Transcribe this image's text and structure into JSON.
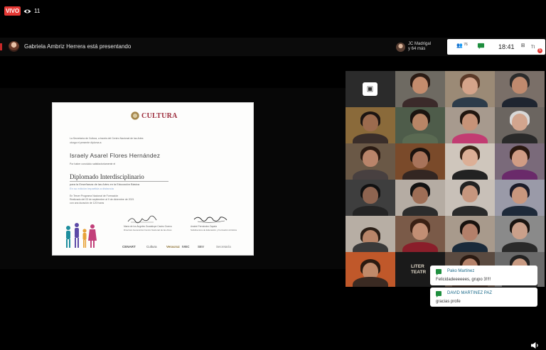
{
  "stream": {
    "live_label": "VIVO",
    "viewers_count": "11"
  },
  "meet": {
    "presenting_text": "Gabriela Ambriz Herrera está presentando",
    "participants_name": "JC Madrigal",
    "participants_more": "y 64 más",
    "participants_badge": "76",
    "time": "18:41",
    "notification_count": "5",
    "accent_color": "#1e8e3e",
    "live_color": "#e53935"
  },
  "diploma": {
    "logo_text": "CULTURA",
    "intro_lines": [
      "La Secretaría de Cultura, a través del Centro Nacional de las Artes",
      "otorga el presente diploma a:"
    ],
    "recipient": "Israely Asarel Flores Hernández",
    "reason": "Por haber concluido satisfactoriamente el",
    "program": "Diplomado Interdisciplinario",
    "program_sub": "para la Enseñanza de las Artes en la Educación Básica",
    "program_sub2": "En su edición impartida a distancia",
    "detail_lines": [
      "En Tercer Programa Nacional de Formación",
      "Realizado del 03 de septiembre al 9 de diciembre de 2021",
      "con una duración de 120 horas"
    ],
    "signer_left": "María de los Ángeles Guadalupe Castro Guerra",
    "signer_left_role": "Directora General del Centro Nacional de las Artes",
    "signer_right": "Anabel Fernández Zapata",
    "signer_right_role": "Subdirectora de Educación y Formación Artística",
    "footer_logos": [
      "CENART",
      "Cultura",
      "Veracruz",
      "IVEC",
      "SEV",
      "Secretaría"
    ]
  },
  "participants": {
    "tile_texts": [
      "LITER",
      "TEATR"
    ]
  },
  "chat": [
    {
      "name": "Pako Martinez",
      "message": "Felicidadeeeeees, grupo 3!!!!"
    },
    {
      "name": "DAVID MARTINEZ PAZ",
      "message": "gracias profe"
    }
  ],
  "icons": {
    "viewers": "eye-icon",
    "volume": "volume-icon",
    "layout": "layout-icon",
    "chat": "chat-icon",
    "people": "people-icon",
    "captions": "captions-icon"
  }
}
